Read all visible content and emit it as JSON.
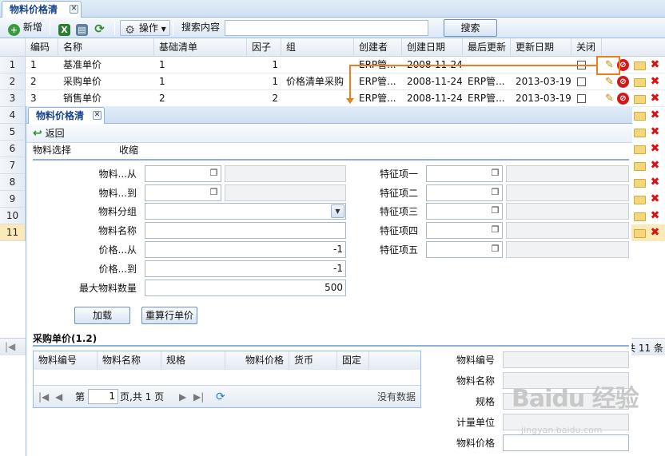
{
  "outer_tab": {
    "label": "物料价格清单"
  },
  "toolbar": {
    "add_label": "新增",
    "operate_label": "操作",
    "search_label": "搜索内容",
    "search_value": "",
    "search_button": "搜索"
  },
  "grid": {
    "columns": [
      "编码",
      "名称",
      "基础清单",
      "因子",
      "组",
      "创建者",
      "创建日期",
      "最后更新",
      "更新日期",
      "关闭"
    ],
    "rows": [
      {
        "n": "1",
        "code": "1",
        "name": "基准单价",
        "base": "1",
        "factor": "1",
        "group": "",
        "creator": "ERP管...",
        "cdate": "2008-11-24",
        "updater": "",
        "udate": ""
      },
      {
        "n": "2",
        "code": "2",
        "name": "采购单价",
        "base": "1",
        "factor": "1",
        "group": "价格清单采购",
        "creator": "ERP管...",
        "cdate": "2008-11-24",
        "updater": "ERP管...",
        "udate": "2013-03-19"
      },
      {
        "n": "3",
        "code": "3",
        "name": "销售单价",
        "base": "2",
        "factor": "2",
        "group": "",
        "creator": "ERP管...",
        "cdate": "2008-11-24",
        "updater": "ERP管...",
        "udate": "2013-03-19"
      }
    ],
    "row_numbers": [
      "4",
      "5",
      "6",
      "7",
      "8",
      "9",
      "10",
      "11"
    ],
    "footer_total": "共 11 条"
  },
  "dialog": {
    "tab_label": "物料价格清单",
    "back_label": "返回",
    "section_label": "物料选择",
    "collapse_label": "收缩",
    "fields_left": [
      {
        "label": "物料...从",
        "value": ""
      },
      {
        "label": "物料...到",
        "value": ""
      },
      {
        "label": "物料分组",
        "value": ""
      },
      {
        "label": "物料名称",
        "value": ""
      },
      {
        "label": "价格...从",
        "value": "-1"
      },
      {
        "label": "价格...到",
        "value": "-1"
      },
      {
        "label": "最大物料数量",
        "value": "500"
      }
    ],
    "fields_right": [
      {
        "label": "特征项一",
        "value": ""
      },
      {
        "label": "特征项二",
        "value": ""
      },
      {
        "label": "特征项三",
        "value": ""
      },
      {
        "label": "特征项四",
        "value": ""
      },
      {
        "label": "特征项五",
        "value": ""
      }
    ],
    "load_button": "加载",
    "recalc_button": "重算行单价",
    "price_section": "采购单价(1.2)",
    "sub_columns": [
      "物料编号",
      "物料名称",
      "规格",
      "物料价格",
      "货币",
      "固定"
    ],
    "pager": {
      "prefix": "第",
      "page": "1",
      "suffix": "页,共 1 页",
      "empty": "没有数据"
    },
    "detail_fields": [
      {
        "label": "物料编号",
        "value": ""
      },
      {
        "label": "物料名称",
        "value": ""
      },
      {
        "label": "规格",
        "value": ""
      },
      {
        "label": "计量单位",
        "value": ""
      },
      {
        "label": "物料价格",
        "value": ""
      }
    ]
  },
  "watermark": {
    "text": "Baidu 经验",
    "sub": "jingyan.baidu.com"
  }
}
